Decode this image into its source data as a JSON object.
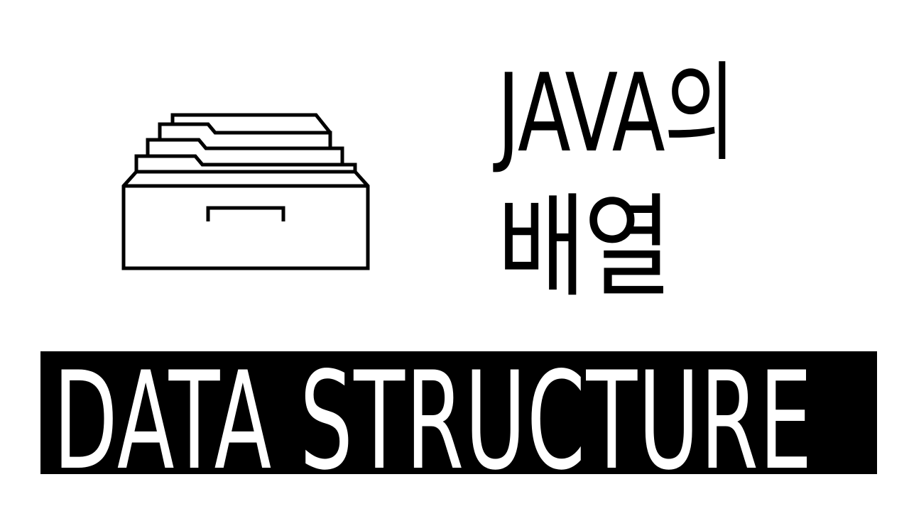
{
  "thumbnail": {
    "icon": "file-drawer-icon",
    "title_line_1": "JAVA의",
    "title_line_2": "배열",
    "banner_text": "DATA STRUCTURE",
    "colors": {
      "background": "#ffffff",
      "foreground": "#000000",
      "banner_background": "#000000",
      "banner_text": "#ffffff"
    }
  }
}
